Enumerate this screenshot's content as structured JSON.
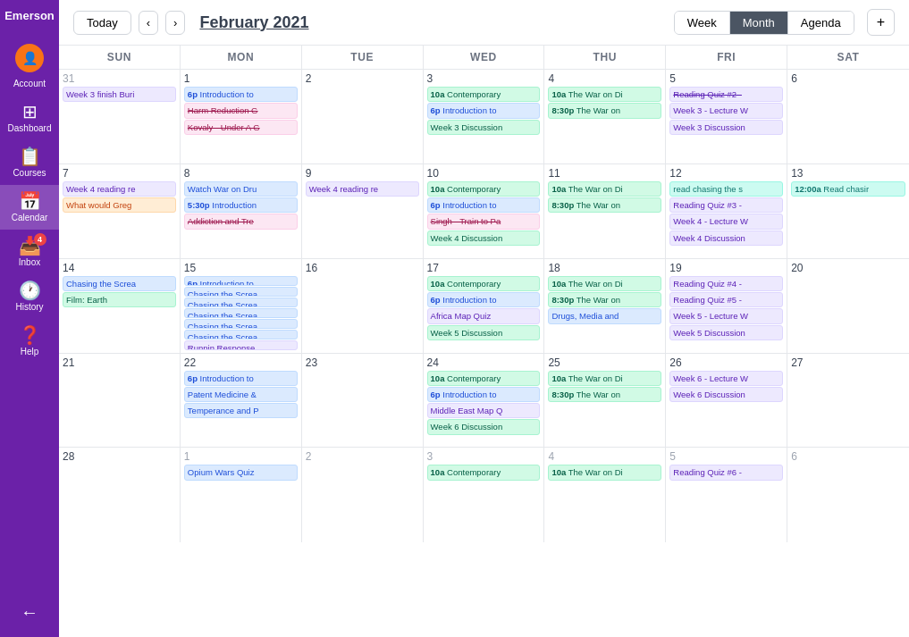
{
  "brand": "Emerson",
  "sidebar": {
    "items": [
      {
        "id": "account",
        "label": "Account",
        "icon": "👤"
      },
      {
        "id": "dashboard",
        "label": "Dashboard",
        "icon": "📊"
      },
      {
        "id": "courses",
        "label": "Courses",
        "icon": "📋"
      },
      {
        "id": "calendar",
        "label": "Calendar",
        "icon": "📅"
      },
      {
        "id": "inbox",
        "label": "Inbox",
        "icon": "📥",
        "badge": "4"
      },
      {
        "id": "history",
        "label": "History",
        "icon": "🕐"
      },
      {
        "id": "help",
        "label": "Help",
        "icon": "❓"
      }
    ],
    "back_icon": "←"
  },
  "topbar": {
    "today": "Today",
    "prev": "‹",
    "next": "›",
    "current_month": "February 2021",
    "views": [
      "Week",
      "Month",
      "Agenda"
    ],
    "active_view": "Month",
    "add": "+"
  },
  "calendar": {
    "headers": [
      "SUN",
      "MON",
      "TUE",
      "WED",
      "THU",
      "FRI",
      "SAT"
    ],
    "weeks": [
      {
        "days": [
          {
            "num": "31",
            "other": true,
            "events": [
              {
                "text": "Week 3 finish Buri",
                "type": "purple"
              }
            ]
          },
          {
            "num": "1",
            "events": [
              {
                "text": "6p Introduction to",
                "type": "blue",
                "bold_prefix": "6p"
              },
              {
                "text": "Harm Reduction G",
                "type": "pink",
                "strikethrough": true
              },
              {
                "text": "Kovaly - Under A G",
                "type": "pink",
                "strikethrough": true
              }
            ]
          },
          {
            "num": "2",
            "events": []
          },
          {
            "num": "3",
            "events": [
              {
                "text": "10a Contemporary",
                "type": "green",
                "bold_prefix": "10a"
              },
              {
                "text": "6p Introduction to",
                "type": "blue",
                "bold_prefix": "6p"
              },
              {
                "text": "Week 3 Discussion",
                "type": "green"
              }
            ]
          },
          {
            "num": "4",
            "events": [
              {
                "text": "10a The War on Di",
                "type": "green",
                "bold_prefix": "10a"
              },
              {
                "text": "8:30p The War on",
                "type": "green",
                "bold_prefix": "8:30p"
              }
            ]
          },
          {
            "num": "5",
            "events": [
              {
                "text": "Reading Quiz #2 -",
                "type": "purple",
                "strikethrough": true
              },
              {
                "text": "Week 3 - Lecture W",
                "type": "purple"
              },
              {
                "text": "Week 3 Discussion",
                "type": "purple"
              }
            ]
          },
          {
            "num": "6",
            "events": []
          }
        ]
      },
      {
        "days": [
          {
            "num": "7",
            "events": [
              {
                "text": "Week 4 reading re",
                "type": "purple"
              },
              {
                "text": "What would Greg",
                "type": "orange"
              }
            ]
          },
          {
            "num": "8",
            "events": [
              {
                "text": "Watch War on Dru",
                "type": "blue"
              },
              {
                "text": "5:30p Introduction",
                "type": "blue",
                "bold_prefix": "5:30p"
              },
              {
                "text": "Addiction and Tre",
                "type": "pink",
                "strikethrough": true
              }
            ]
          },
          {
            "num": "9",
            "events": [
              {
                "text": "Week 4 reading re",
                "type": "purple"
              }
            ]
          },
          {
            "num": "10",
            "events": [
              {
                "text": "10a Contemporary",
                "type": "green",
                "bold_prefix": "10a"
              },
              {
                "text": "6p Introduction to",
                "type": "blue",
                "bold_prefix": "6p"
              },
              {
                "text": "Singh - Train to Pa",
                "type": "pink",
                "strikethrough": true
              },
              {
                "text": "Week 4 Discussion",
                "type": "green"
              }
            ]
          },
          {
            "num": "11",
            "events": [
              {
                "text": "10a The War on Di",
                "type": "green",
                "bold_prefix": "10a"
              },
              {
                "text": "8:30p The War on",
                "type": "green",
                "bold_prefix": "8:30p"
              }
            ]
          },
          {
            "num": "12",
            "events": [
              {
                "text": "read chasing the s",
                "type": "teal"
              },
              {
                "text": "Reading Quiz #3 -",
                "type": "purple"
              },
              {
                "text": "Week 4 - Lecture W",
                "type": "purple"
              },
              {
                "text": "Week 4 Discussion",
                "type": "purple"
              }
            ]
          },
          {
            "num": "13",
            "events": [
              {
                "text": "12:00a Read chasir",
                "type": "teal",
                "bold_prefix": "12:00a"
              }
            ]
          }
        ]
      },
      {
        "days": [
          {
            "num": "14",
            "events": [
              {
                "text": "Chasing the Screa",
                "type": "blue"
              },
              {
                "text": "Film: Earth",
                "type": "green"
              }
            ]
          },
          {
            "num": "15",
            "events": [
              {
                "text": "6p Introduction to",
                "type": "blue",
                "bold_prefix": "6p"
              },
              {
                "text": "Chasing the Screa",
                "type": "blue"
              },
              {
                "text": "Chasing the Screa",
                "type": "blue"
              },
              {
                "text": "Chasing the Screa",
                "type": "blue"
              },
              {
                "text": "Chasing the Screa",
                "type": "blue"
              },
              {
                "text": "Chasing the Screa",
                "type": "blue"
              },
              {
                "text": "Runnin Response",
                "type": "purple"
              }
            ]
          },
          {
            "num": "16",
            "events": []
          },
          {
            "num": "17",
            "events": [
              {
                "text": "10a Contemporary",
                "type": "green",
                "bold_prefix": "10a"
              },
              {
                "text": "6p Introduction to",
                "type": "blue",
                "bold_prefix": "6p"
              },
              {
                "text": "Africa Map Quiz",
                "type": "purple"
              },
              {
                "text": "Week 5 Discussion",
                "type": "green"
              }
            ]
          },
          {
            "num": "18",
            "events": [
              {
                "text": "10a The War on Di",
                "type": "green",
                "bold_prefix": "10a"
              },
              {
                "text": "8:30p The War on",
                "type": "green",
                "bold_prefix": "8:30p"
              },
              {
                "text": "Drugs, Media and",
                "type": "blue"
              }
            ]
          },
          {
            "num": "19",
            "events": [
              {
                "text": "Reading Quiz #4 -",
                "type": "purple"
              },
              {
                "text": "Reading Quiz #5 -",
                "type": "purple"
              },
              {
                "text": "Week 5 - Lecture W",
                "type": "purple"
              },
              {
                "text": "Week 5 Discussion",
                "type": "purple"
              }
            ]
          },
          {
            "num": "20",
            "events": []
          }
        ]
      },
      {
        "days": [
          {
            "num": "21",
            "events": []
          },
          {
            "num": "22",
            "events": [
              {
                "text": "6p Introduction to",
                "type": "blue",
                "bold_prefix": "6p"
              },
              {
                "text": "Patent Medicine &",
                "type": "blue"
              },
              {
                "text": "Temperance and P",
                "type": "blue"
              }
            ]
          },
          {
            "num": "23",
            "events": []
          },
          {
            "num": "24",
            "events": [
              {
                "text": "10a Contemporary",
                "type": "green",
                "bold_prefix": "10a"
              },
              {
                "text": "6p Introduction to",
                "type": "blue",
                "bold_prefix": "6p"
              },
              {
                "text": "Middle East Map Q",
                "type": "purple"
              },
              {
                "text": "Week 6 Discussion",
                "type": "green"
              }
            ]
          },
          {
            "num": "25",
            "events": [
              {
                "text": "10a The War on Di",
                "type": "green",
                "bold_prefix": "10a"
              },
              {
                "text": "8:30p The War on",
                "type": "green",
                "bold_prefix": "8:30p"
              }
            ]
          },
          {
            "num": "26",
            "events": [
              {
                "text": "Week 6 - Lecture W",
                "type": "purple"
              },
              {
                "text": "Week 6 Discussion",
                "type": "purple"
              }
            ]
          },
          {
            "num": "27",
            "events": []
          }
        ]
      },
      {
        "days": [
          {
            "num": "28",
            "events": []
          },
          {
            "num": "1",
            "other": true,
            "events": [
              {
                "text": "Opium Wars Quiz",
                "type": "blue"
              }
            ]
          },
          {
            "num": "2",
            "other": true,
            "events": []
          },
          {
            "num": "3",
            "other": true,
            "events": [
              {
                "text": "10a Contemporary",
                "type": "green",
                "bold_prefix": "10a"
              }
            ]
          },
          {
            "num": "4",
            "other": true,
            "events": [
              {
                "text": "10a The War on Di",
                "type": "green",
                "bold_prefix": "10a"
              }
            ]
          },
          {
            "num": "5",
            "other": true,
            "events": [
              {
                "text": "Reading Quiz #6 -",
                "type": "purple"
              }
            ]
          },
          {
            "num": "6",
            "other": true,
            "events": []
          }
        ]
      }
    ]
  }
}
